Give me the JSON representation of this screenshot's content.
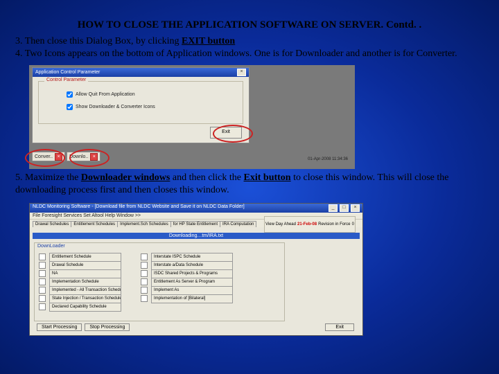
{
  "title": "HOW TO CLOSE THE APPLICATION SOFTWARE ON SERVER.  Contd. .",
  "step3_a": "3. Then close this Dialog Box, by clicking ",
  "step3_b": "EXIT button",
  "step4": "4. Two Icons appears on the bottom of Application windows. One is for Downloader and another is for Converter.",
  "step5_a": "5. Maximize the ",
  "step5_b": "Downloader windows",
  "step5_c": " and then click the ",
  "step5_d": "Exit button",
  "step5_e": " to close this window. This will close the downloading process first and then closes this window.",
  "shot1": {
    "dialog_title": "Application Control Parameter",
    "legend": "Control Parameter",
    "chk1": "Allow Quit From Application",
    "chk2": "Show Downloader & Converter Icons",
    "exit": "Exit",
    "task_convert": "Conver..",
    "task_download": "Downlo..",
    "date": "01-Apr-2008    11:34:36"
  },
  "shot2": {
    "win_title": "NLDC Monitoring Software - [Download file from NLDC Website and Save it on NLDC Data Folder]",
    "menu": "File  Foresight  Services  Set Altool  Help  Window  >>",
    "tabs": [
      "Drawal Schedules",
      "Entitlement Schedules",
      "Implement.Sch Schedules",
      "for HP State Entitlement",
      "IRA Computation"
    ],
    "top_view": "View Day Ahead",
    "top_date": "21-Feb-08",
    "top_rev": "Revision in Force",
    "top_num": "0",
    "status": "Downloading…tm/IRA.txt",
    "panel_title": "DownLoader",
    "left": [
      "Entitlement Schedule",
      "Drawal Schedule",
      "NA",
      "Implementation Schedule",
      "Implemented - All Transaction Schedule",
      "State Injection / Transaction Schedule",
      "Declared Capability Schedule"
    ],
    "right": [
      "Interstate ISPC Schedule",
      "Interstate a/Data Schedule",
      "ISDC Shared Projects & Programs",
      "Entitlement As Server & Program",
      "Implement As",
      "Implementation of [Bilateral]"
    ],
    "start": "Start Processing",
    "stop": "Stop Processing",
    "exit": "Exit"
  }
}
